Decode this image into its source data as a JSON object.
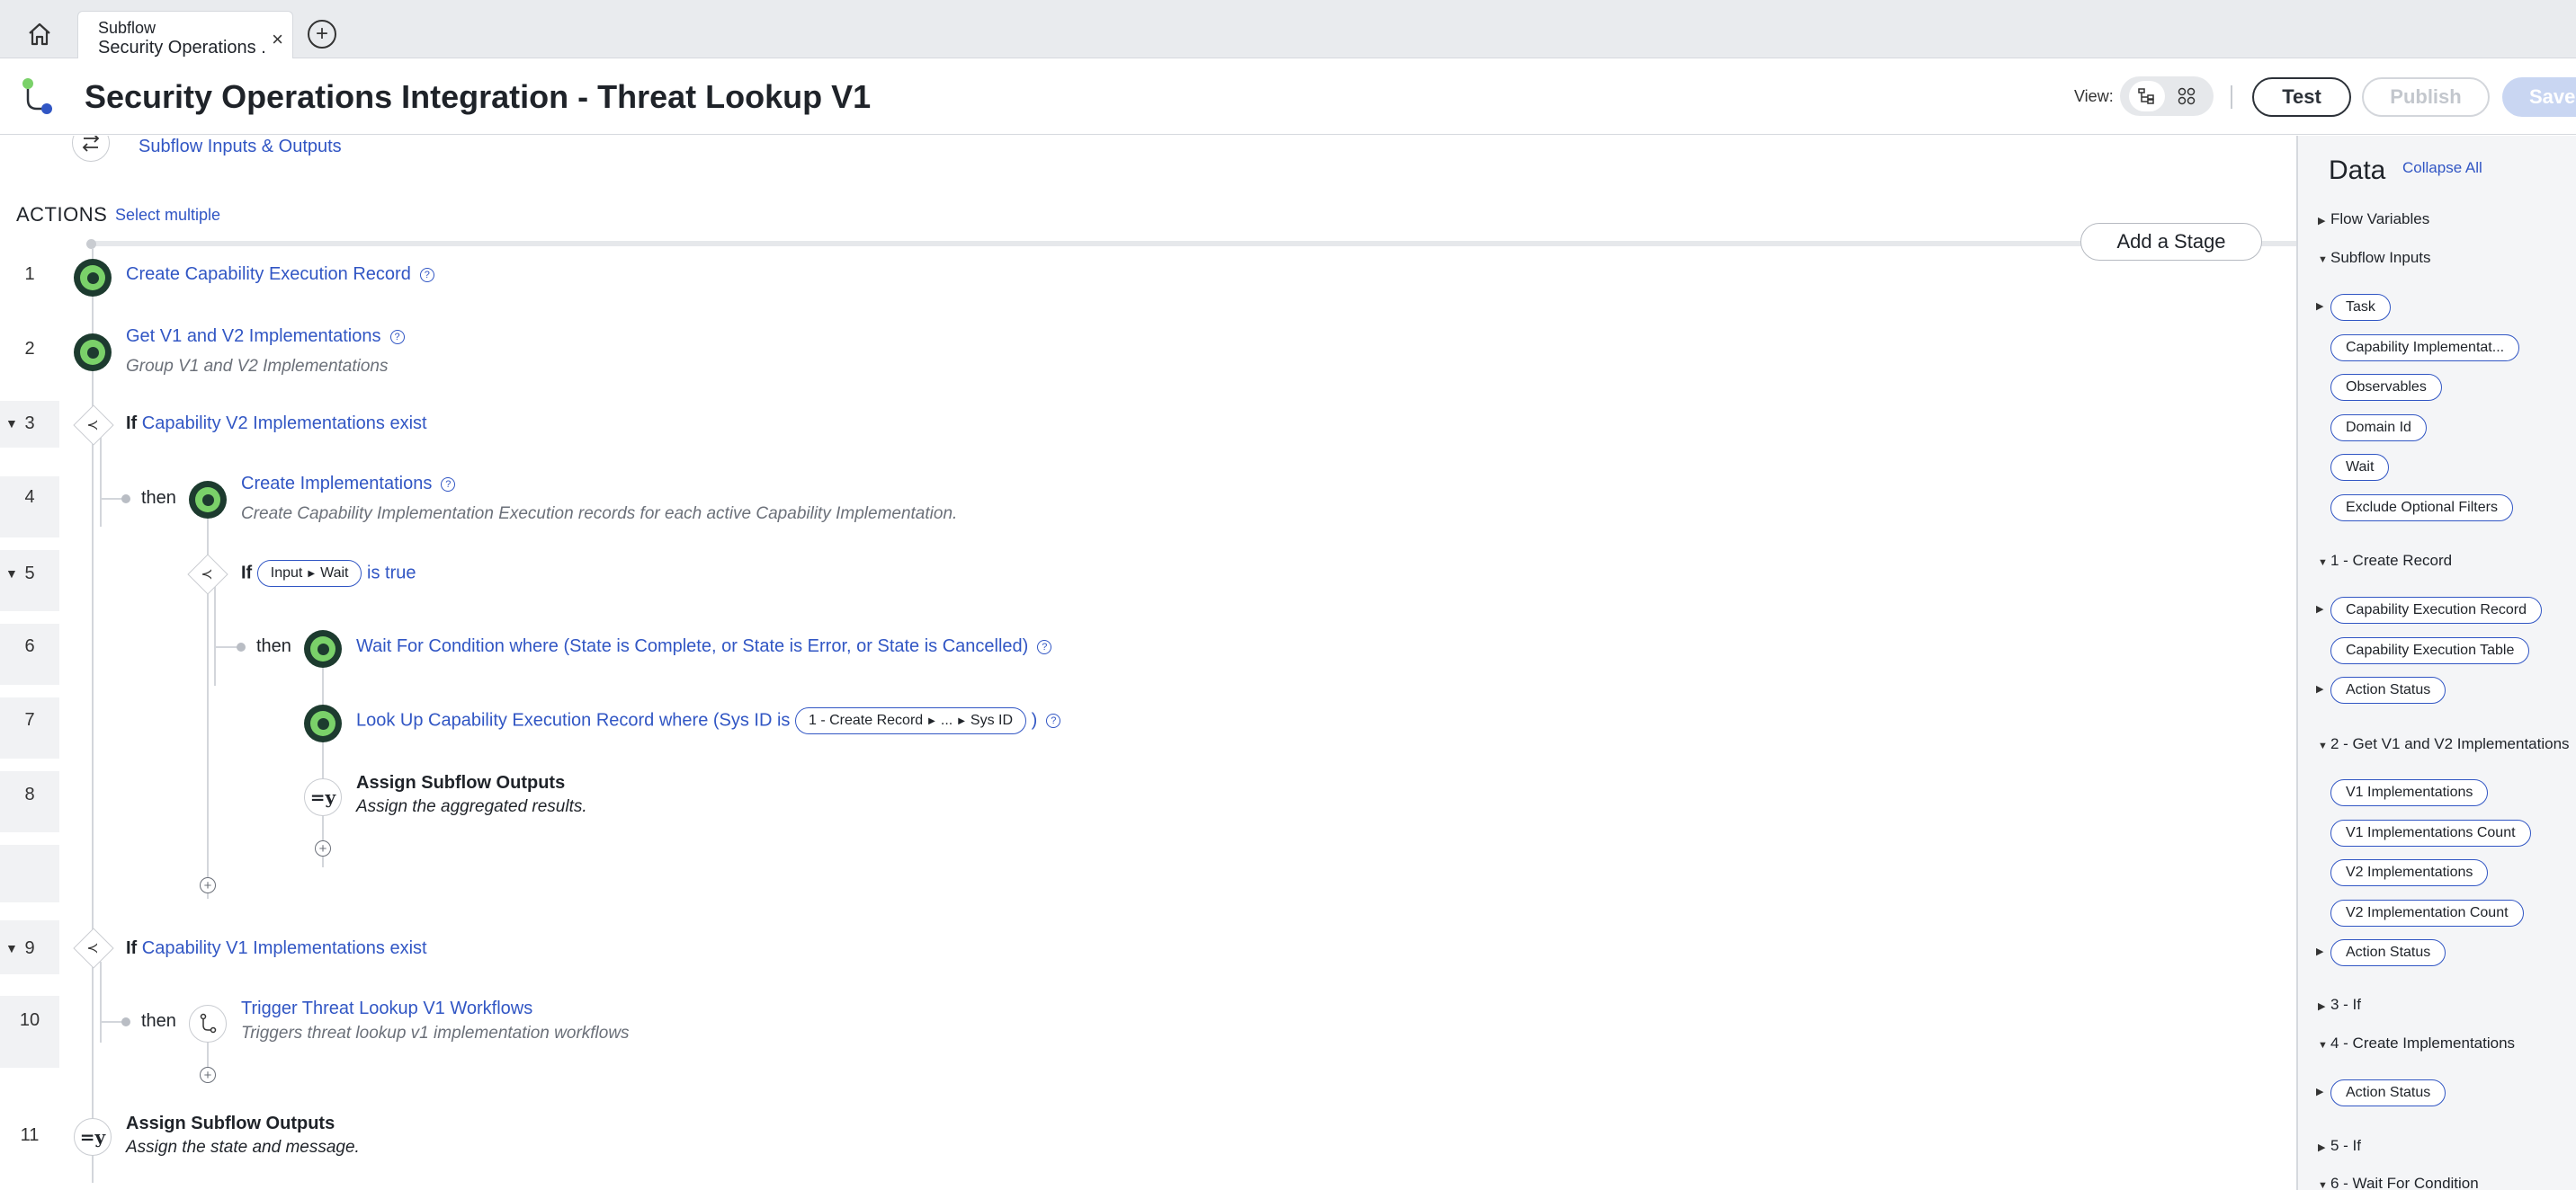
{
  "tab": {
    "type": "Subflow",
    "name": "Security Operations ...",
    "close": "×",
    "add": "+"
  },
  "header": {
    "title": "Security Operations Integration - Threat Lookup V1",
    "view_label": "View:",
    "test_label": "Test",
    "publish_label": "Publish",
    "save_label": "Save"
  },
  "flow": {
    "io_link": "Subflow Inputs & Outputs",
    "actions_title": "ACTIONS",
    "select_multiple": "Select multiple",
    "add_stage": "Add a Stage",
    "if_kw": "If",
    "then_kw": "then",
    "rows": [
      "1",
      "2",
      "3",
      "4",
      "5",
      "6",
      "7",
      "8",
      "9",
      "10",
      "11"
    ],
    "steps": {
      "s1": "Create Capability Execution Record",
      "s2": "Get V1 and V2 Implementations",
      "s2_desc": "Group V1 and V2 Implementations",
      "s3": "Capability V2 Implementations exist",
      "s4": "Create Implementations",
      "s4_desc": "Create Capability Implementation Execution records for each active Capability Implementation.",
      "s5_pill_a": "Input",
      "s5_pill_b": "Wait",
      "s5_tail": "is true",
      "s6": "Wait For Condition where (State is Complete, or State is Error, or State is Cancelled)",
      "s7": "Look Up Capability Execution Record where (Sys ID is",
      "s7_pill_a": "1 - Create Record",
      "s7_pill_b": "...",
      "s7_pill_c": "Sys ID",
      "s7_tail": ")",
      "s8": "Assign Subflow Outputs",
      "s8_desc": "Assign the aggregated results.",
      "s9": "Capability V1 Implementations exist",
      "s10": "Trigger Threat Lookup V1 Workflows",
      "s10_desc": "Triggers threat lookup v1 implementation workflows",
      "s11": "Assign Subflow Outputs",
      "s11_desc": "Assign the state and message."
    },
    "assign_glyph": "=y"
  },
  "data_panel": {
    "title": "Data",
    "collapse_all": "Collapse All",
    "flow_variables": "Flow Variables",
    "subflow_inputs": "Subflow Inputs",
    "inputs": [
      "Task",
      "Capability Implementat...",
      "Observables",
      "Domain Id",
      "Wait",
      "Exclude Optional Filters"
    ],
    "create_record": "1 - Create Record",
    "create_record_items": [
      "Capability Execution Record",
      "Capability Execution Table",
      "Action Status"
    ],
    "get_impl": "2 - Get V1 and V2 Implementations",
    "get_impl_items": [
      "V1 Implementations",
      "V1 Implementations Count",
      "V2 Implementations",
      "V2 Implementation Count",
      "Action Status"
    ],
    "if3": "3 - If",
    "create_impl": "4 - Create Implementations",
    "create_impl_items": [
      "Action Status"
    ],
    "if5": "5 - If",
    "wait6": "6 - Wait For Condition"
  },
  "colors": {
    "accent": "#3156c4",
    "action_green": "#7ad169",
    "action_dark": "#1d3b2f",
    "save_disabled": "#c9d6f2"
  },
  "icons": [
    "home-icon",
    "flow-logo-icon",
    "tree-view-icon",
    "grid-view-icon",
    "swap-arrows-icon",
    "help-icon",
    "if-branch-icon",
    "action-icon",
    "assign-icon",
    "trigger-subflow-icon",
    "add-step-icon",
    "collapse-triangle-icon"
  ]
}
